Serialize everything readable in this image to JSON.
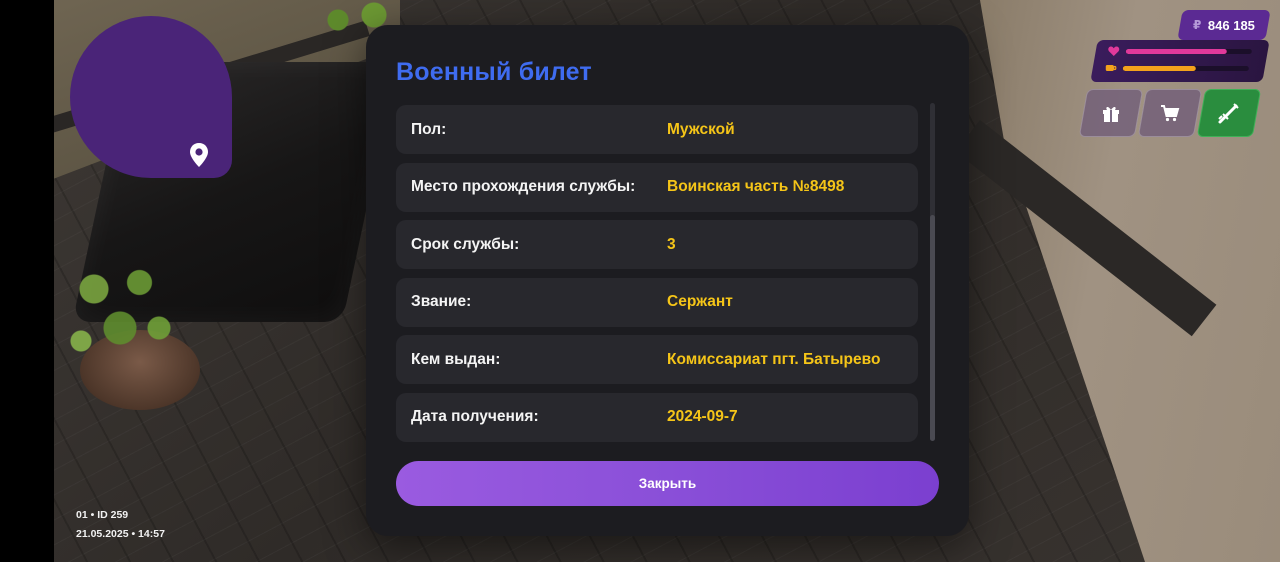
{
  "hud": {
    "currency_symbol": "₽",
    "money": "846 185",
    "health_level": 0.8,
    "food_level": 0.58,
    "icons": [
      "heart-icon",
      "cup-icon",
      "gift-icon",
      "cart-icon",
      "weapon-icon",
      "map-pin-icon"
    ],
    "colors": {
      "accent": "#5b2a93",
      "health": "#e0399b",
      "food": "#f3a21c",
      "weapon_btn": "#2a8d3e",
      "minimap": "#4a2478"
    }
  },
  "sys_info": {
    "line1": "01 • ID 259",
    "line2": "21.05.2025 • 14:57"
  },
  "dialog": {
    "title": "Военный билет",
    "rows": [
      {
        "label": "Пол:",
        "value": "Мужской"
      },
      {
        "label": "Место прохождения службы:",
        "value": "Воинская часть №8498"
      },
      {
        "label": "Срок службы:",
        "value": "3"
      },
      {
        "label": "Звание:",
        "value": "Сержант"
      },
      {
        "label": "Кем выдан:",
        "value": "Комиссариат пгт. Батырево"
      },
      {
        "label": "Дата получения:",
        "value": "2024-09-7"
      }
    ],
    "close_label": "Закрыть",
    "colors": {
      "title": "#3f6cf0",
      "value": "#f5c518",
      "button": "#8a4fd8"
    }
  }
}
